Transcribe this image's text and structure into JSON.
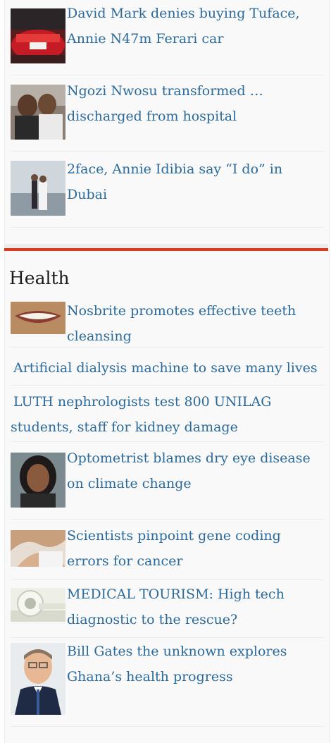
{
  "top_items": [
    {
      "title": "David Mark denies buying Tuface, Annie N47m Ferari car",
      "thumb": "red-car-photo"
    },
    {
      "title": "Ngozi Nwosu transformed … discharged from hospital",
      "thumb": "two-women-photo"
    },
    {
      "title": "2face, Annie Idibia say “I do” in Dubai",
      "thumb": "wedding-photo"
    }
  ],
  "health": {
    "section_title": "Health",
    "items": [
      {
        "title": "Nosbrite promotes effective teeth cleansing",
        "thumb": "smile-teeth-photo"
      },
      {
        "title": "Artificial dialysis machine to save many lives"
      },
      {
        "title": "LUTH nephrologists test 800 UNILAG students, staff for kidney damage"
      },
      {
        "title": "Optometrist blames dry eye disease on climate change",
        "thumb": "woman-portrait-photo"
      },
      {
        "title": "Scientists pinpoint gene coding errors for cancer",
        "thumb": "hands-photo"
      },
      {
        "title": "MEDICAL TOURISM: High tech diagnostic to the rescue?",
        "thumb": "scanner-machine-photo"
      },
      {
        "title": "Bill Gates the unknown explores Ghana’s health progress",
        "thumb": "bill-gates-photo"
      }
    ]
  },
  "colors": {
    "link": "#2b6a9a",
    "accent_rule": "#d93b1e"
  }
}
